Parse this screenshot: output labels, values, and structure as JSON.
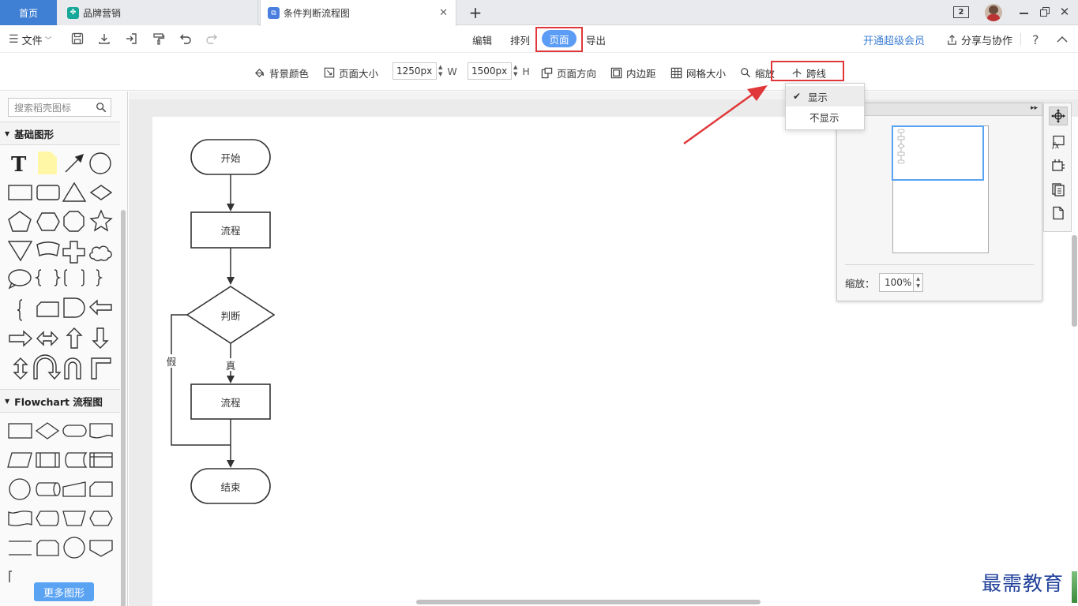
{
  "tabs": {
    "home": "首页",
    "brand": "品牌营销",
    "flow": "条件判断流程图",
    "close": "✕",
    "add": "+"
  },
  "window": {
    "badge": "2"
  },
  "toolbar1": {
    "file": "文件",
    "menu_edit": "编辑",
    "menu_arrange": "排列",
    "menu_page": "页面",
    "menu_export": "导出",
    "vip": "开通超级会员",
    "share": "分享与协作",
    "help": "?"
  },
  "toolbar2": {
    "bg_color": "背景颜色",
    "page_size": "页面大小",
    "width_value": "1250px",
    "width_unit": "W",
    "height_value": "1500px",
    "height_unit": "H",
    "orientation": "页面方向",
    "padding": "内边距",
    "grid_size": "网格大小",
    "zoom": "缩放",
    "jump_line": "跨线"
  },
  "dropdown": {
    "items": [
      {
        "label": "显示",
        "checked": true
      },
      {
        "label": "不显示",
        "checked": false
      }
    ],
    "check": "✔"
  },
  "sidebar": {
    "search_placeholder": "搜索稻壳图标",
    "section_basic": "基础图形",
    "section_flowchart": "Flowchart 流程图",
    "more_button": "更多图形"
  },
  "flowchart": {
    "start": "开始",
    "process1": "流程",
    "decision": "判断",
    "true_label": "真",
    "false_label": "假",
    "process2": "流程",
    "end": "结束"
  },
  "minimap": {
    "zoom_label": "缩放：",
    "zoom_value": "100%"
  },
  "watermark": "最需教育",
  "colors": {
    "accent": "#3f7fd4",
    "page_tab_active": "#5b9cf5",
    "highlight_red": "#e0383a",
    "vip_link": "#3f7fd4"
  }
}
